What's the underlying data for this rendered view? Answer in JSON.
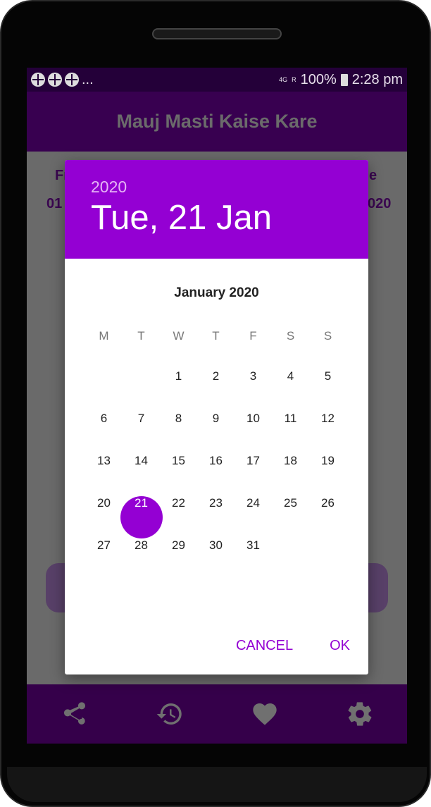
{
  "status": {
    "time": "2:28 pm",
    "battery": "100%",
    "network": "4G",
    "roaming": "R",
    "more": "..."
  },
  "app": {
    "title": "Mauj Masti Kaise Kare"
  },
  "background": {
    "left_label": "Fr",
    "right_label": "e",
    "left_value": "01",
    "right_value": "020"
  },
  "dialog": {
    "year": "2020",
    "date": "Tue, 21 Jan",
    "month": "January 2020",
    "weekdays": [
      "M",
      "T",
      "W",
      "T",
      "F",
      "S",
      "S"
    ],
    "weeks": [
      [
        "",
        "",
        "1",
        "2",
        "3",
        "4",
        "5"
      ],
      [
        "6",
        "7",
        "8",
        "9",
        "10",
        "11",
        "12"
      ],
      [
        "13",
        "14",
        "15",
        "16",
        "17",
        "18",
        "19"
      ],
      [
        "20",
        "21",
        "22",
        "23",
        "24",
        "25",
        "26"
      ],
      [
        "27",
        "28",
        "29",
        "30",
        "31",
        "",
        ""
      ]
    ],
    "selected": "21",
    "cancel": "CANCEL",
    "ok": "OK"
  },
  "colors": {
    "accent": "#9400d3",
    "appbar": "#380050",
    "bottom_nav": "#35004a"
  },
  "bottom_nav": [
    "share-icon",
    "history-icon",
    "heart-icon",
    "gear-icon"
  ]
}
